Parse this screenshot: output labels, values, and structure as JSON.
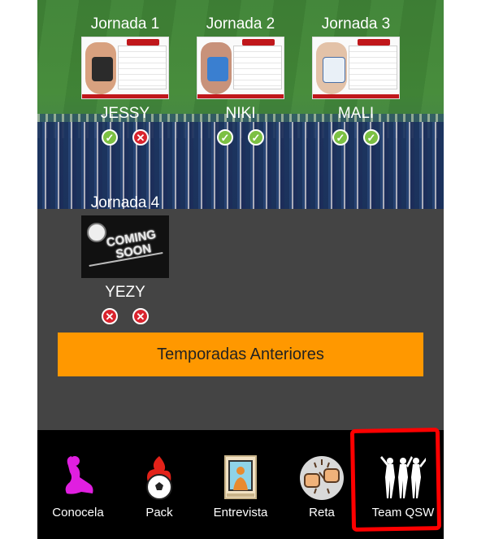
{
  "jornadas": [
    {
      "title": "Jornada 1",
      "name": "JESSY",
      "marks": [
        "check",
        "cross"
      ]
    },
    {
      "title": "Jornada 2",
      "name": "NIKI",
      "marks": [
        "check",
        "check"
      ]
    },
    {
      "title": "Jornada 3",
      "name": "MALI",
      "marks": [
        "check",
        "check"
      ]
    },
    {
      "title": "Jornada 4",
      "name": "YEZY",
      "marks": [
        "cross",
        "cross"
      ],
      "thumb_text": "COMING SOON"
    }
  ],
  "temporadas_label": "Temporadas Anteriores",
  "nav": {
    "items": [
      {
        "label": "Conocela",
        "icon": "silhouette-pose-icon"
      },
      {
        "label": "Pack",
        "icon": "flaming-ball-icon"
      },
      {
        "label": "Entrevista",
        "icon": "framed-photo-icon"
      },
      {
        "label": "Reta",
        "icon": "fist-bump-icon"
      },
      {
        "label": "Team QSW",
        "icon": "dancers-silhouette-icon"
      }
    ],
    "highlighted": "Team QSW"
  },
  "colors": {
    "accent": "#ff9800",
    "check": "#7cc043",
    "cross": "#d9232d",
    "panel": "#444444",
    "nav_bg": "#000000",
    "highlight": "#ff0000"
  }
}
